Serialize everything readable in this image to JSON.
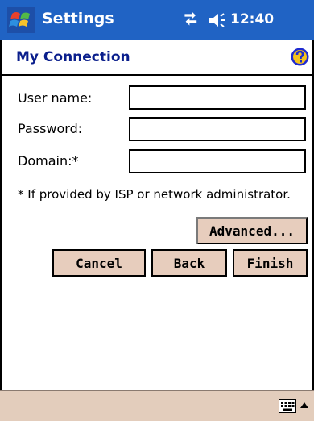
{
  "titlebar": {
    "app_name": "Settings",
    "time": "12:40"
  },
  "header": {
    "title": "My Connection"
  },
  "form": {
    "username": {
      "label": "User name:",
      "value": ""
    },
    "password": {
      "label": "Password:",
      "value": ""
    },
    "domain": {
      "label": "Domain:*",
      "value": ""
    },
    "note": "* If provided by ISP or network administrator."
  },
  "buttons": {
    "advanced": "Advanced...",
    "cancel": "Cancel",
    "back": "Back",
    "finish": "Finish"
  },
  "icons": {
    "start": "windows-flag-icon",
    "connectivity": "connectivity-icon",
    "volume": "speaker-icon",
    "help": "help-icon",
    "keyboard": "keyboard-icon",
    "sip_menu": "up-arrow-icon"
  },
  "colors": {
    "titlebar": "#2063c4",
    "header_text": "#0a1e8c",
    "button_face": "#e7cdbd",
    "bottombar": "#e3cdbc"
  }
}
